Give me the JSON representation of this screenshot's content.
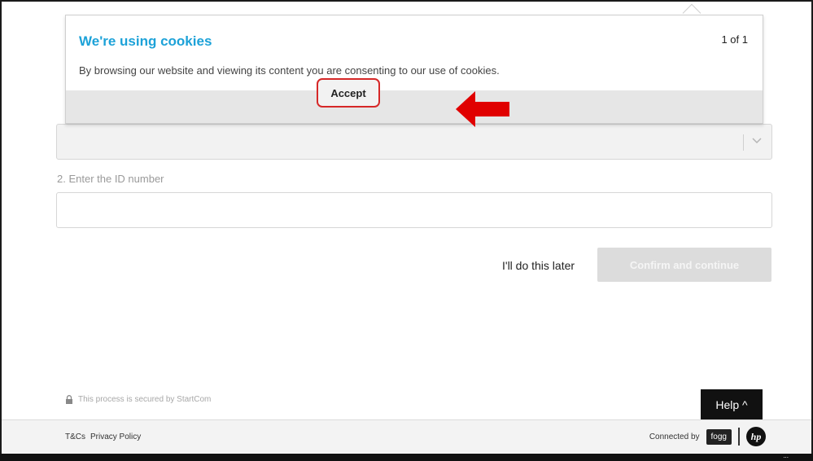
{
  "cookie_banner": {
    "title": "We're using cookies",
    "pager": "1 of 1",
    "message": "By browsing our website and viewing its content you are consenting to our use of cookies.",
    "accept_label": "Accept",
    "title_color": "#1da2d8",
    "highlight_color": "#d62828"
  },
  "form": {
    "select_value": "",
    "id_label": "2. Enter the ID number",
    "id_value": "",
    "later_label": "I'll do this later",
    "confirm_label": "Confirm and continue"
  },
  "secure_note": "This process is secured by StartCom",
  "help_label": "Help ^",
  "footer": {
    "tcs_label": "T&Cs",
    "privacy_label": "Privacy Policy",
    "connected_label": "Connected by",
    "fogg_logo": "fogg",
    "hp_logo": "hp"
  },
  "taskbar_dots": "..."
}
